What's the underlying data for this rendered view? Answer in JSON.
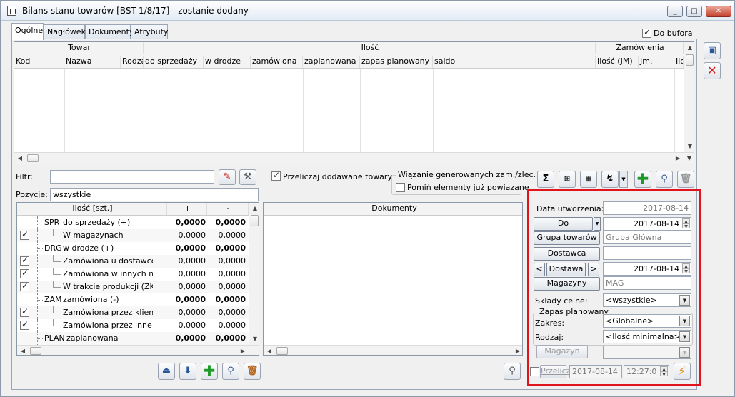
{
  "window": {
    "title": "Bilans stanu towarów [BST-1/8/17] - zostanie dodany",
    "controls": [
      "minimize",
      "maximize",
      "close"
    ]
  },
  "tabs": [
    "Ogólne",
    "Nagłówek",
    "Dokumenty",
    "Atrybuty"
  ],
  "active_tab": "Ogólne",
  "do_bufora": {
    "label": "Do bufora",
    "checked": true
  },
  "main_grid": {
    "group_headers": [
      "Towar",
      "Ilość",
      "Zamówienia"
    ],
    "columns": [
      "Kod",
      "Nazwa",
      "Rodza",
      "do sprzedaży",
      "w drodze",
      "zamówiona",
      "zaplanowana",
      "zapas planowany",
      "saldo",
      "Ilość (JM)",
      "Jm.",
      "Ilo"
    ]
  },
  "filter": {
    "label": "Filtr:",
    "value": ""
  },
  "pozycje": {
    "label": "Pozycje:",
    "value": "wszystkie"
  },
  "przeliczaj": {
    "label": "Przeliczaj dodawane towary",
    "checked": true
  },
  "wiazanie": {
    "title": "Wiązanie generowanych zam./zlec.",
    "pomin_label": "Pomiń elementy już powiązane",
    "pomin_checked": false
  },
  "qty_grid": {
    "headers": [
      "Ilość [szt.]",
      "+",
      "-"
    ],
    "rows": [
      {
        "checked": false,
        "code": "SPR",
        "name": "do sprzedaży (+)",
        "plus": "0,0000",
        "minus": "0,0000",
        "bold": true,
        "level": 0
      },
      {
        "checked": true,
        "code": "",
        "name": "W magazynach",
        "plus": "0,0000",
        "minus": "0,0000",
        "bold": false,
        "level": 1
      },
      {
        "checked": false,
        "code": "DRG",
        "name": "w drodze (+)",
        "plus": "0,0000",
        "minus": "0,0000",
        "bold": true,
        "level": 0
      },
      {
        "checked": true,
        "code": "",
        "name": "Zamówiona u dostawców (",
        "plus": "0,0000",
        "minus": "0,0000",
        "bold": false,
        "level": 1
      },
      {
        "checked": true,
        "code": "",
        "name": "Zamówiona w innych maga",
        "plus": "0,0000",
        "minus": "0,0000",
        "bold": false,
        "level": 1
      },
      {
        "checked": true,
        "code": "",
        "name": "W trakcie produkcji (ZK, Zl",
        "plus": "0,0000",
        "minus": "0,0000",
        "bold": false,
        "level": 1
      },
      {
        "checked": false,
        "code": "ZAM",
        "name": "zamówiona (-)",
        "plus": "0,0000",
        "minus": "0,0000",
        "bold": true,
        "level": 0
      },
      {
        "checked": true,
        "code": "",
        "name": "Zamówiona przez klientów",
        "plus": "0,0000",
        "minus": "0,0000",
        "bold": false,
        "level": 1
      },
      {
        "checked": true,
        "code": "",
        "name": "Zamówiona przez inne ma",
        "plus": "0,0000",
        "minus": "0,0000",
        "bold": false,
        "level": 1
      },
      {
        "checked": false,
        "code": "PLAN",
        "name": "zaplanowana",
        "plus": "0,0000",
        "minus": "0,0000",
        "bold": true,
        "level": 0
      }
    ]
  },
  "dokumenty_grid": {
    "header": "Dokumenty"
  },
  "right_panel": {
    "data_utworzenia_label": "Data utworzenia:",
    "data_utworzenia": "2017-08-14",
    "do_label": "Do",
    "do_date": "2017-08-14",
    "grupa_label": "Grupa towarów",
    "grupa_value": "Grupa Główna",
    "dostawca_label": "Dostawca",
    "dostawca_value": "",
    "dostawa_label": "Dostawa",
    "dostawa_prev": "<",
    "dostawa_next": ">",
    "dostawa_date": "2017-08-14",
    "magazyny_label": "Magazyny",
    "magazyny_value": "MAG",
    "sklady_label": "Składy celne:",
    "sklady_value": "<wszystkie>",
    "zapas_label": "Zapas planowany",
    "zakres_label": "Zakres:",
    "zakres_value": "<Globalne>",
    "rodzaj_label": "Rodzaj:",
    "rodzaj_value": "<Ilość minimalna>",
    "magazyn_label": "Magazyn",
    "magazyn_value": "",
    "przelicz_label": "Przelicz",
    "przelicz_checked": false,
    "przelicz_date": "2017-08-14",
    "przelicz_time": "12:27:0"
  },
  "colors": {
    "highlight_border": "#e1131c",
    "accent": "#2b5797"
  }
}
